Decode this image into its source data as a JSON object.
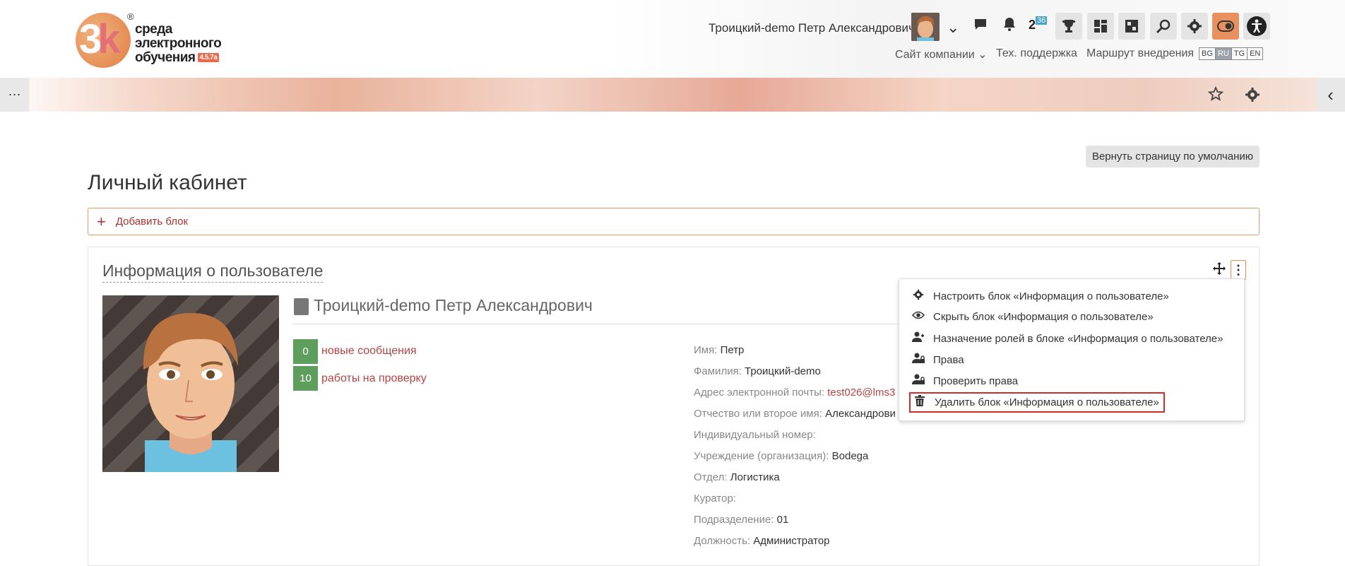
{
  "header": {
    "logo": {
      "reg": "®",
      "line1": "среда",
      "line2": "электронного",
      "line3": "обучения",
      "version": "4.5.7a"
    },
    "user_name": "Троицкий-demo Петр Александрович",
    "badge_value": "36",
    "badge_main": "2",
    "links": [
      "Сайт компании",
      "Тех. поддержка",
      "Маршрут внедрения"
    ],
    "languages": [
      "BG",
      "RU",
      "TG",
      "EN"
    ],
    "active_language": "RU"
  },
  "icons": {
    "dots": "⋯",
    "chevron_left": "‹",
    "chevron_down": "⌄"
  },
  "page": {
    "reset_button": "Вернуть страницу по умолчанию",
    "title": "Личный кабинет",
    "add_block": "Добавить блок"
  },
  "block": {
    "title": "Информация о пользователе",
    "full_name": "Троицкий-demo Петр Александрович",
    "stats": [
      {
        "count": "0",
        "label": "новые сообщения"
      },
      {
        "count": "10",
        "label": "работы на проверку"
      }
    ],
    "fields": [
      {
        "label": "Имя:",
        "value": "Петр"
      },
      {
        "label": "Фамилия:",
        "value": "Троицкий-demo"
      },
      {
        "label": "Адрес электронной почты:",
        "value": "test026@lms3"
      },
      {
        "label": "Отчество или второе имя:",
        "value": "Александрови"
      },
      {
        "label": "Индивидуальный номер:",
        "value": ""
      },
      {
        "label": "Учреждение (организация):",
        "value": "Bodega"
      },
      {
        "label": "Отдел:",
        "value": "Логистика"
      },
      {
        "label": "Куратор:",
        "value": ""
      },
      {
        "label": "Подразделение:",
        "value": "01"
      },
      {
        "label": "Должность:",
        "value": "Администратор"
      }
    ]
  },
  "menu": {
    "items": [
      "Настроить блок «Информация о пользователе»",
      "Скрыть блок «Информация о пользователе»",
      "Назначение ролей в блоке «Информация о пользователе»",
      "Права",
      "Проверить права",
      "Удалить блок «Информация о пользователе»"
    ],
    "highlighted_index": 5
  },
  "colors": {
    "accent": "#e48c53",
    "link": "#b34444",
    "stat_green": "#5e9e5c",
    "highlight": "#d42a2a"
  }
}
